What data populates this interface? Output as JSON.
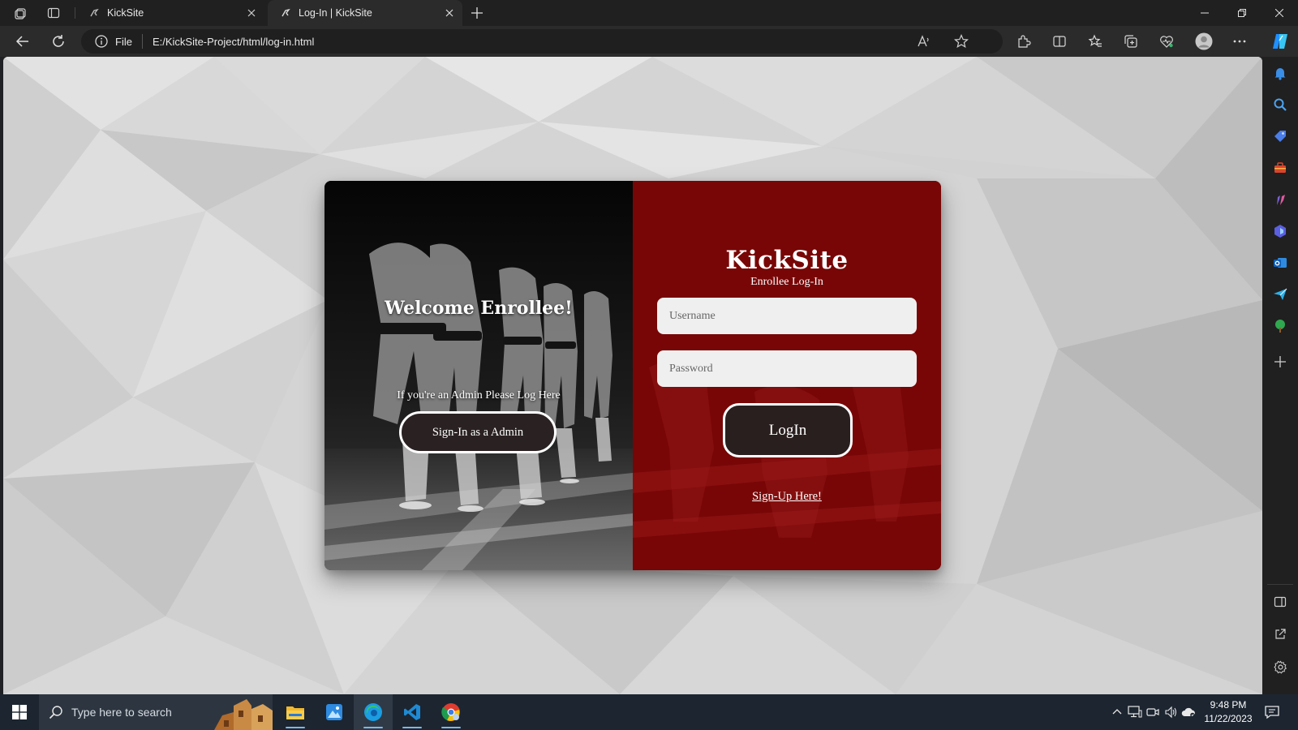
{
  "browser": {
    "tabs": [
      {
        "title": "KickSite",
        "active": false
      },
      {
        "title": "Log-In | KickSite",
        "active": true
      }
    ],
    "address": {
      "scheme_label": "File",
      "url": "E:/KickSite-Project/html/log-in.html"
    }
  },
  "page": {
    "left_panel": {
      "welcome": "Welcome Enrollee!",
      "admin_note": "If you're an Admin Please Log Here",
      "admin_button": "Sign-In as a Admin"
    },
    "right_panel": {
      "brand": "KickSite",
      "subtitle": "Enrollee Log-In",
      "username_placeholder": "Username",
      "password_placeholder": "Password",
      "login_button": "LogIn",
      "signup_link": "Sign-Up Here!"
    },
    "colors": {
      "right_panel": "#7a0707",
      "button_fill": "#2a1f1f",
      "background": "#d6d6d6"
    }
  },
  "taskbar": {
    "search_placeholder": "Type here to search",
    "time": "9:48 PM",
    "date": "11/22/2023",
    "apps": [
      "file-explorer",
      "photos",
      "edge",
      "vs-code",
      "chrome"
    ]
  }
}
